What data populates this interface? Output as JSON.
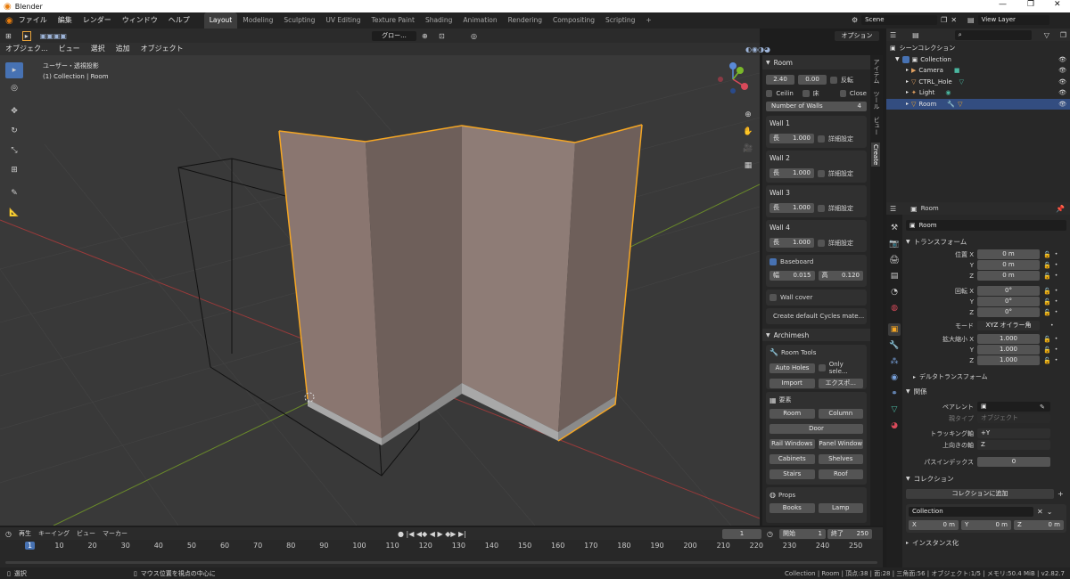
{
  "app": {
    "title": "Blender"
  },
  "menus": [
    "ファイル",
    "編集",
    "レンダー",
    "ウィンドウ",
    "ヘルプ"
  ],
  "workspace_tabs": [
    "Layout",
    "Modeling",
    "Sculpting",
    "UV Editing",
    "Texture Paint",
    "Shading",
    "Animation",
    "Rendering",
    "Compositing",
    "Scripting"
  ],
  "active_workspace": "Layout",
  "scene": {
    "label": "Scene",
    "view_layer": "View Layer"
  },
  "viewport": {
    "header_left": [
      "オブジェク...",
      "ビュー",
      "選択",
      "追加",
      "オブジェクト"
    ],
    "transform_orientation": "グロー...",
    "options": "オプション",
    "overlay_title": "ユーザー・透視投影",
    "overlay_sub": "(1) Collection | Room"
  },
  "room_panel": {
    "title": "Room",
    "height": "2.40",
    "thickness": "0.00",
    "flip": "反転",
    "ceiling": "Ceilin",
    "floor": "床",
    "close": "Close",
    "num_walls_label": "Number of Walls",
    "num_walls": "4",
    "walls": [
      {
        "title": "Wall 1",
        "len_label": "長",
        "len": "1.000",
        "adv": "詳細設定"
      },
      {
        "title": "Wall 2",
        "len_label": "長",
        "len": "1.000",
        "adv": "詳細設定"
      },
      {
        "title": "Wall 3",
        "len_label": "長",
        "len": "1.000",
        "adv": "詳細設定"
      },
      {
        "title": "Wall 4",
        "len_label": "長",
        "len": "1.000",
        "adv": "詳細設定"
      }
    ],
    "baseboard": "Baseboard",
    "bb_width_label": "幅",
    "bb_width": "0.015",
    "bb_height_label": "高",
    "bb_height": "0.120",
    "wall_cover": "Wall cover",
    "cycles": "Create default Cycles mate..."
  },
  "archimesh": {
    "title": "Archimesh",
    "room_tools": "Room Tools",
    "auto_holes": "Auto Holes",
    "only_sel": "Only sele...",
    "import": "Import",
    "export": "エクスポ...",
    "elements_title": "要素",
    "room": "Room",
    "column": "Column",
    "door": "Door",
    "rail_windows": "Rail Windows",
    "panel_window": "Panel Window",
    "cabinets": "Cabinets",
    "shelves": "Shelves",
    "stairs": "Stairs",
    "roof": "Roof",
    "props": "Props",
    "books": "Books",
    "lamp": "Lamp"
  },
  "side_tabs": [
    "アイテム",
    "ツール",
    "ビュー",
    "Create"
  ],
  "outliner": {
    "root": "シーンコレクション",
    "collection": "Collection",
    "items": [
      "Camera",
      "CTRL_Hole",
      "Light",
      "Room"
    ]
  },
  "properties": {
    "object_name": "Room",
    "data_name": "Room",
    "transform_title": "トランスフォーム",
    "location_label": "位置 X",
    "y": "Y",
    "z": "Z",
    "x": "X",
    "location": [
      "0 m",
      "0 m",
      "0 m"
    ],
    "rotation_label": "回転 X",
    "rotation": [
      "0°",
      "0°",
      "0°"
    ],
    "mode_label": "モード",
    "mode": "XYZ オイラー角",
    "scale_label": "拡大縮小 X",
    "scale": [
      "1.000",
      "1.000",
      "1.000"
    ],
    "delta": "デルタトランスフォーム",
    "relations": "関係",
    "parent_label": "ペアレント",
    "parent_type_label": "親タイプ",
    "parent_type": "オブジェクト",
    "tracking_label": "トラッキング軸",
    "tracking": "+Y",
    "up_label": "上向きの軸",
    "up": "Z",
    "pass_label": "パスインデックス",
    "pass": "0",
    "collections_title": "コレクション",
    "add_to_collection": "コレクションに追加",
    "coll_name": "Collection",
    "cx": "X",
    "cy": "Y",
    "cz": "Z",
    "cxv": "0 m",
    "cyv": "0 m",
    "czv": "0 m",
    "instancing": "インスタンス化"
  },
  "timeline": {
    "play": "再生",
    "keying": "キーイング",
    "view": "ビュー",
    "marker": "マーカー",
    "current": "1",
    "start_label": "開始",
    "start": "1",
    "end_label": "終了",
    "end": "250",
    "ticks": [
      "1",
      "10",
      "20",
      "30",
      "40",
      "50",
      "60",
      "70",
      "80",
      "90",
      "100",
      "110",
      "120",
      "130",
      "140",
      "150",
      "160",
      "170",
      "180",
      "190",
      "200",
      "210",
      "220",
      "230",
      "240",
      "250"
    ]
  },
  "status": {
    "select": "選択",
    "center": "マウス位置を視点の中心に",
    "stats": "Collection | Room | 頂点:38 | 面:28 | 三角面:56 | オブジェクト:1/5 | メモリ:50.4 MiB | v2.82.7"
  },
  "colors": {
    "accent": "#4772b3",
    "select": "#f5a623",
    "header": "#2b2b2b",
    "panel": "#303030",
    "viewport": "#393939"
  }
}
